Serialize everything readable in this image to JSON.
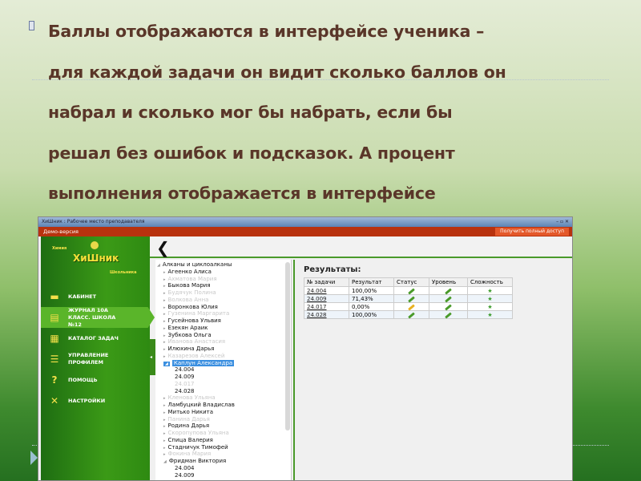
{
  "slide": {
    "lines": [
      "Баллы отображаются в интерфейсе ученика –",
      "для каждой задачи он видит сколько баллов он",
      "набрал и сколько мог бы набрать, если бы",
      "решал без ошибок и подсказок. А процент",
      "выполнения отображается в интерфейсе"
    ]
  },
  "window": {
    "title": "ХиШник : Рабочее место преподавателя",
    "demo_label": "Демо-версия",
    "full_access_button": "Получить полный доступ"
  },
  "logo": {
    "name": "ХиШник",
    "top": "Химия",
    "bottom": "Школьника"
  },
  "sidebar": {
    "items": [
      {
        "label": "КАБИНЕТ",
        "icon": "desk-icon"
      },
      {
        "label": "ЖУРНАЛ 10А КЛАСС. ШКОЛА №12",
        "icon": "journal-icon",
        "active": true
      },
      {
        "label": "КАТАЛОГ ЗАДАЧ",
        "icon": "catalog-icon"
      },
      {
        "label": "УПРАВЛЕНИЕ ПРОФИЛЕМ",
        "icon": "profile-icon"
      },
      {
        "label": "ПОМОЩЬ",
        "icon": "help-icon"
      },
      {
        "label": "НАСТРОЙКИ",
        "icon": "settings-icon"
      }
    ]
  },
  "tree": [
    {
      "t": "Алканы и циклоалканы",
      "l": 0
    },
    {
      "t": "Агеенко  Алиса",
      "l": 1
    },
    {
      "t": "Ахматова  Мария",
      "l": 1,
      "g": 1
    },
    {
      "t": "Быкова  Мария",
      "l": 1
    },
    {
      "t": "Будячук  Полина",
      "l": 1,
      "g": 1
    },
    {
      "t": "Волкова  Анна",
      "l": 1,
      "g": 1
    },
    {
      "t": "Воронкова  Юлия",
      "l": 1
    },
    {
      "t": "Гузенина  Маргарита",
      "l": 1,
      "g": 1
    },
    {
      "t": "Гусейнова  Ульвия",
      "l": 1
    },
    {
      "t": "Езекян  Араик",
      "l": 1
    },
    {
      "t": "Зубкова  Ольга",
      "l": 1
    },
    {
      "t": "Иванова  Анастасия",
      "l": 1,
      "g": 1
    },
    {
      "t": "Илюхина  Дарья",
      "l": 1
    },
    {
      "t": "Казарезов  Алексей",
      "l": 1,
      "g": 1
    },
    {
      "t": "Каплун  Александра",
      "l": 1,
      "s": 1,
      "o": 1
    },
    {
      "t": "24.004",
      "l": 2
    },
    {
      "t": "24.009",
      "l": 2
    },
    {
      "t": "24.017",
      "l": 2,
      "g": 1
    },
    {
      "t": "24.028",
      "l": 2
    },
    {
      "t": "Кленова  Ульяна",
      "l": 1,
      "g": 1
    },
    {
      "t": "Ламбуцкий  Владислав",
      "l": 1
    },
    {
      "t": "Митько  Никита",
      "l": 1
    },
    {
      "t": "Панина  Дарья",
      "l": 1,
      "g": 1
    },
    {
      "t": "Родина  Дарья",
      "l": 1
    },
    {
      "t": "Скоропупова  Ульяна",
      "l": 1,
      "g": 1
    },
    {
      "t": "Спица  Валерия",
      "l": 1
    },
    {
      "t": "Стадничук  Тимофей",
      "l": 1
    },
    {
      "t": "Фокина  Мария",
      "l": 1,
      "g": 1
    },
    {
      "t": "Фридман  Виктория",
      "l": 1,
      "o": 1
    },
    {
      "t": "24.004",
      "l": 2
    },
    {
      "t": "24.009",
      "l": 2
    }
  ],
  "results": {
    "title": "Результаты:",
    "columns": [
      "№ задачи",
      "Результат",
      "Статус",
      "Уровень",
      "Сложность"
    ],
    "rows": [
      {
        "task": "24.004",
        "result": "100,00%",
        "status": "complete"
      },
      {
        "task": "24.009",
        "result": "71,43%",
        "status": "complete"
      },
      {
        "task": "24.017",
        "result": "0,00%",
        "status": "partial"
      },
      {
        "task": "24.028",
        "result": "100,00%",
        "status": "complete"
      }
    ]
  },
  "colors": {
    "complete": "#4a9a2a",
    "partial": "#e8b020"
  }
}
